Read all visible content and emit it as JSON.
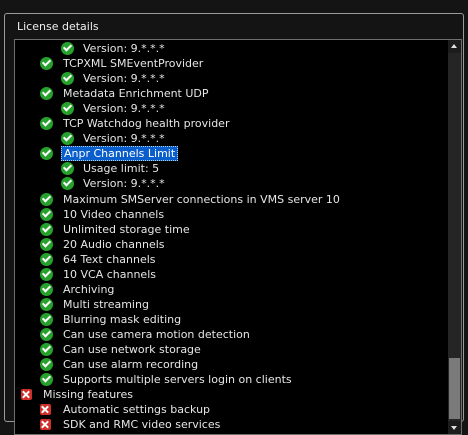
{
  "group": {
    "title": "License details"
  },
  "tree": {
    "rows": [
      {
        "status": "ok",
        "depth": 2,
        "label": "Version: 9.*.*.*"
      },
      {
        "status": "ok",
        "depth": 1,
        "label": "TCPXML SMEventProvider"
      },
      {
        "status": "ok",
        "depth": 2,
        "label": "Version: 9.*.*.*"
      },
      {
        "status": "ok",
        "depth": 1,
        "label": "Metadata Enrichment UDP"
      },
      {
        "status": "ok",
        "depth": 2,
        "label": "Version: 9.*.*.*"
      },
      {
        "status": "ok",
        "depth": 1,
        "label": "TCP Watchdog health provider"
      },
      {
        "status": "ok",
        "depth": 2,
        "label": "Version: 9.*.*.*"
      },
      {
        "status": "ok",
        "depth": 1,
        "label": "Anpr Channels Limit",
        "selected": true
      },
      {
        "status": "ok",
        "depth": 2,
        "label": "Usage limit: 5"
      },
      {
        "status": "ok",
        "depth": 2,
        "label": "Version: 9.*.*.*"
      },
      {
        "status": "ok",
        "depth": 1,
        "label": "Maximum SMServer connections in VMS server 10"
      },
      {
        "status": "ok",
        "depth": 1,
        "label": "10 Video channels"
      },
      {
        "status": "ok",
        "depth": 1,
        "label": "Unlimited storage time"
      },
      {
        "status": "ok",
        "depth": 1,
        "label": "20 Audio channels"
      },
      {
        "status": "ok",
        "depth": 1,
        "label": "64 Text channels"
      },
      {
        "status": "ok",
        "depth": 1,
        "label": "10 VCA channels"
      },
      {
        "status": "ok",
        "depth": 1,
        "label": "Archiving"
      },
      {
        "status": "ok",
        "depth": 1,
        "label": "Multi streaming"
      },
      {
        "status": "ok",
        "depth": 1,
        "label": "Blurring mask editing"
      },
      {
        "status": "ok",
        "depth": 1,
        "label": "Can use camera motion detection"
      },
      {
        "status": "ok",
        "depth": 1,
        "label": "Can use network storage"
      },
      {
        "status": "ok",
        "depth": 1,
        "label": "Can use alarm recording"
      },
      {
        "status": "ok",
        "depth": 1,
        "label": "Supports multiple servers login on clients"
      },
      {
        "status": "missing",
        "depth": 0,
        "label": "Missing features"
      },
      {
        "status": "missing",
        "depth": 1,
        "label": "Automatic settings backup"
      },
      {
        "status": "missing",
        "depth": 1,
        "label": "SDK and RMC video services"
      }
    ]
  }
}
